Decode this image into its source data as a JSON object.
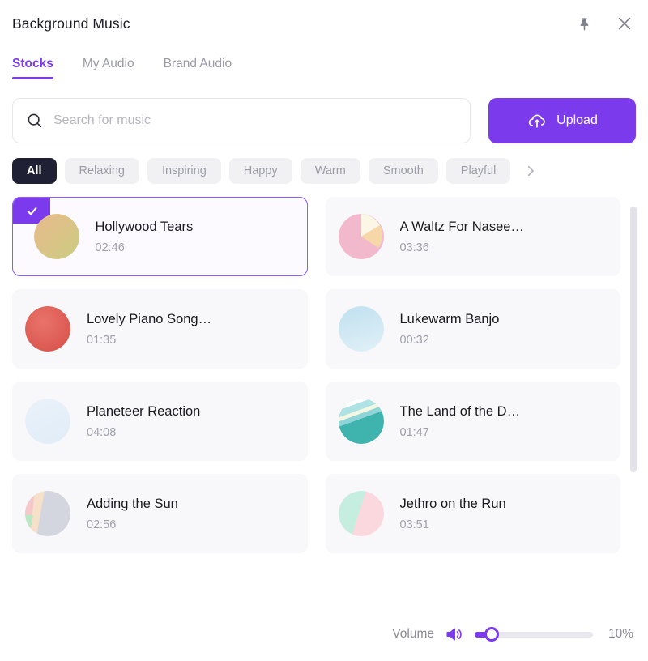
{
  "header": {
    "title": "Background Music",
    "pin_icon": "pin-icon",
    "close_icon": "close-icon"
  },
  "tabs": [
    {
      "label": "Stocks",
      "active": true
    },
    {
      "label": "My Audio",
      "active": false
    },
    {
      "label": "Brand Audio",
      "active": false
    }
  ],
  "search": {
    "placeholder": "Search for music",
    "value": "",
    "icon": "search-icon"
  },
  "upload": {
    "label": "Upload",
    "icon": "upload-cloud-icon",
    "color": "#7c3aed"
  },
  "chips": [
    {
      "label": "All",
      "active": true
    },
    {
      "label": "Relaxing",
      "active": false
    },
    {
      "label": "Inspiring",
      "active": false
    },
    {
      "label": "Happy",
      "active": false
    },
    {
      "label": "Warm",
      "active": false
    },
    {
      "label": "Smooth",
      "active": false
    },
    {
      "label": "Playful",
      "active": false
    }
  ],
  "chips_next_icon": "chevron-right-icon",
  "tracks": [
    {
      "title": "Hollywood Tears",
      "duration": "02:46",
      "selected": true,
      "art": "gold-sand"
    },
    {
      "title": "A Waltz For Nasee…",
      "duration": "03:36",
      "selected": false,
      "art": "pink-cream-pie"
    },
    {
      "title": "Lovely Piano Song…",
      "duration": "01:35",
      "selected": false,
      "art": "red-solid"
    },
    {
      "title": "Lukewarm Banjo",
      "duration": "00:32",
      "selected": false,
      "art": "light-blue"
    },
    {
      "title": "Planeteer Reaction",
      "duration": "04:08",
      "selected": false,
      "art": "pale-blue"
    },
    {
      "title": "The Land of the D…",
      "duration": "01:47",
      "selected": false,
      "art": "teal-stripes"
    },
    {
      "title": "Adding the Sun",
      "duration": "02:56",
      "selected": false,
      "art": "pastel-grey"
    },
    {
      "title": "Jethro on the Run",
      "duration": "03:51",
      "selected": false,
      "art": "mint-pink"
    },
    {
      "title": "",
      "duration": "",
      "selected": false,
      "art": "blank"
    },
    {
      "title": "",
      "duration": "",
      "selected": false,
      "art": "blank"
    }
  ],
  "footer": {
    "volume_label": "Volume",
    "speaker_icon": "speaker-icon",
    "volume_percent": "10%",
    "volume_value": 10
  },
  "colors": {
    "accent": "#7c3aed",
    "chip_active_bg": "#1f2033",
    "card_bg": "#f8f8fa",
    "muted_text": "#9a9aa6"
  }
}
